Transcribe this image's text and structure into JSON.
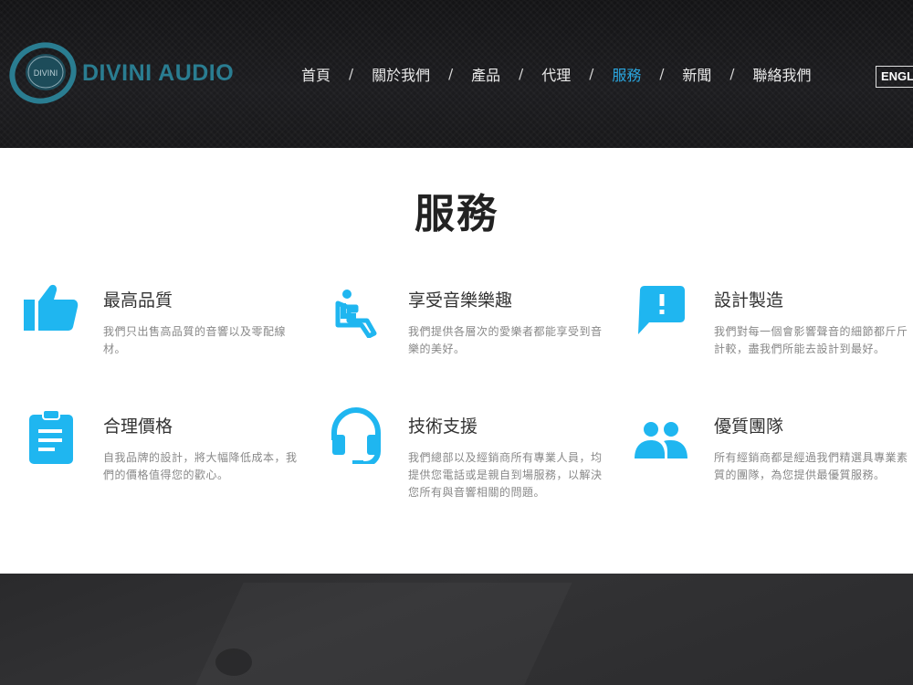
{
  "brand": {
    "name": "DIVINI AUDIO",
    "mark_text": "DIVINI"
  },
  "nav": {
    "items": [
      {
        "label": "首頁"
      },
      {
        "label": "關於我們"
      },
      {
        "label": "產品"
      },
      {
        "label": "代理"
      },
      {
        "label": "服務",
        "active": true
      },
      {
        "label": "新聞"
      },
      {
        "label": "聯絡我們"
      }
    ],
    "separator": "/",
    "language": "ENGLISH"
  },
  "section": {
    "title": "服務"
  },
  "services": [
    {
      "icon": "thumbs-up-icon",
      "title": "最高品質",
      "desc": "我們只出售高品質的音響以及零配線材。"
    },
    {
      "icon": "accessible-seat-icon",
      "title": "享受音樂樂趣",
      "desc": "我們提供各層次的愛樂者都能享受到音樂的美好。"
    },
    {
      "icon": "feedback-icon",
      "title": "設計製造",
      "desc": "我們對每一個會影響聲音的細節都斤斤計較，盡我們所能去設計到最好。"
    },
    {
      "icon": "clipboard-icon",
      "title": "合理價格",
      "desc": "自我品牌的設計，將大幅降低成本，我們的價格值得您的歡心。"
    },
    {
      "icon": "headset-icon",
      "title": "技術支援",
      "desc": "我們總部以及經銷商所有專業人員，均提供您電話或是親自到場服務，以解決您所有與音響相關的問題。"
    },
    {
      "icon": "people-icon",
      "title": "優質團隊",
      "desc": "所有經銷商都是經過我們精選具專業素質的團隊，為您提供最優質服務。"
    }
  ],
  "colors": {
    "accent": "#2aa7e0",
    "icon": "#1fb6f0",
    "brand": "#2a7d91"
  }
}
